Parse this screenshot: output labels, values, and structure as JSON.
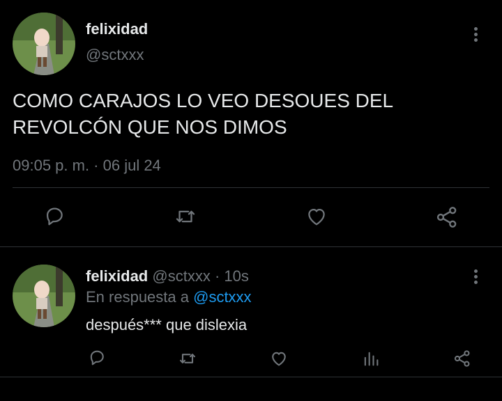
{
  "main_tweet": {
    "display_name": "felixidad",
    "handle": "@sctxxx",
    "text_line1": "COMO CARAJOS LO VEO DESOUES DEL",
    "text_line2": "REVOLCÓN QUE NOS DIMOS",
    "timestamp": "09:05 p. m. · 06 jul 24",
    "actions": [
      "reply-icon",
      "retweet-icon",
      "like-icon",
      "share-icon"
    ]
  },
  "reply_tweet": {
    "display_name": "felixidad",
    "handle": "@sctxxx",
    "time": "· 10s",
    "reply_prefix": "En respuesta a",
    "reply_to": "@sctxxx",
    "text": "después*** que dislexia",
    "actions": [
      "reply-icon",
      "retweet-icon",
      "like-icon",
      "views-icon",
      "share-icon"
    ]
  },
  "colors": {
    "background": "#000000",
    "text": "#e7e9ea",
    "muted": "#71767b",
    "accent": "#1d9bf0",
    "divider": "#2f3336"
  }
}
